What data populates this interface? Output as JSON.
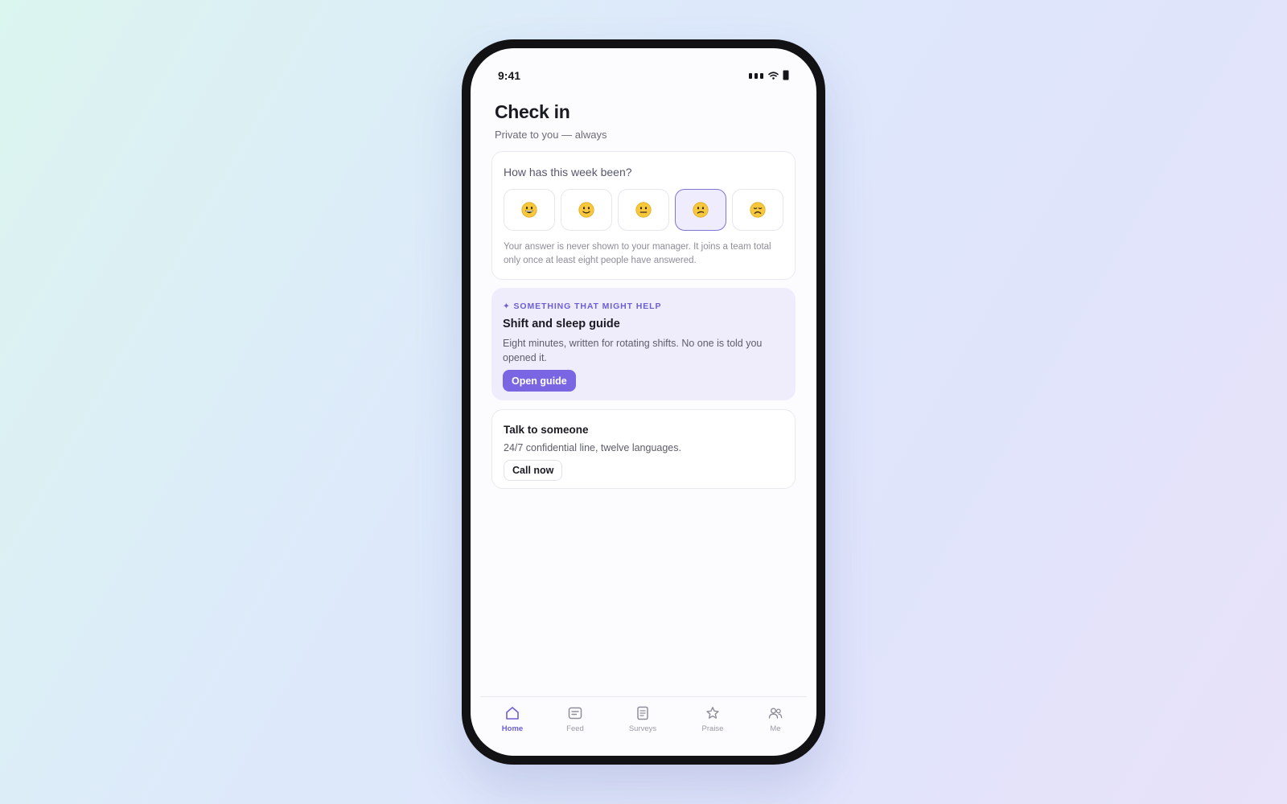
{
  "status_bar": {
    "time": "9:41"
  },
  "header": {
    "title": "Check in",
    "subtitle": "Private to you — always"
  },
  "mood_card": {
    "question": "How has this week been?",
    "options": [
      {
        "emoji": "😀",
        "icon": "grinning-face",
        "selected": false
      },
      {
        "emoji": "🙂",
        "icon": "slightly-smiling-face",
        "selected": false
      },
      {
        "emoji": "😐",
        "icon": "neutral-face",
        "selected": false
      },
      {
        "emoji": "😕",
        "icon": "confused-face",
        "selected": true
      },
      {
        "emoji": "😞",
        "icon": "disappointed-face",
        "selected": false
      }
    ],
    "privacy_note": "Your answer is never shown to your manager. It joins a team total only once at least eight people have answered."
  },
  "help_card": {
    "eyebrow": "✦ SOMETHING THAT MIGHT HELP",
    "title": "Shift and sleep guide",
    "description": "Eight minutes, written for rotating shifts. No one is told you opened it.",
    "button_label": "Open guide"
  },
  "talk_card": {
    "title": "Talk to someone",
    "description": "24/7 confidential line, twelve languages.",
    "button_label": "Call now"
  },
  "tab_bar": {
    "tabs": [
      {
        "label": "Home",
        "icon": "home-icon",
        "active": true
      },
      {
        "label": "Feed",
        "icon": "feed-icon",
        "active": false
      },
      {
        "label": "Surveys",
        "icon": "surveys-icon",
        "active": false
      },
      {
        "label": "Praise",
        "icon": "star-icon",
        "active": false
      },
      {
        "label": "Me",
        "icon": "people-icon",
        "active": false
      }
    ]
  },
  "colors": {
    "accent": "#7a65e3",
    "accent_text": "#6c5fd6",
    "help_card_bg": "#efedfc",
    "selected_mood_bg": "#efedfd"
  }
}
